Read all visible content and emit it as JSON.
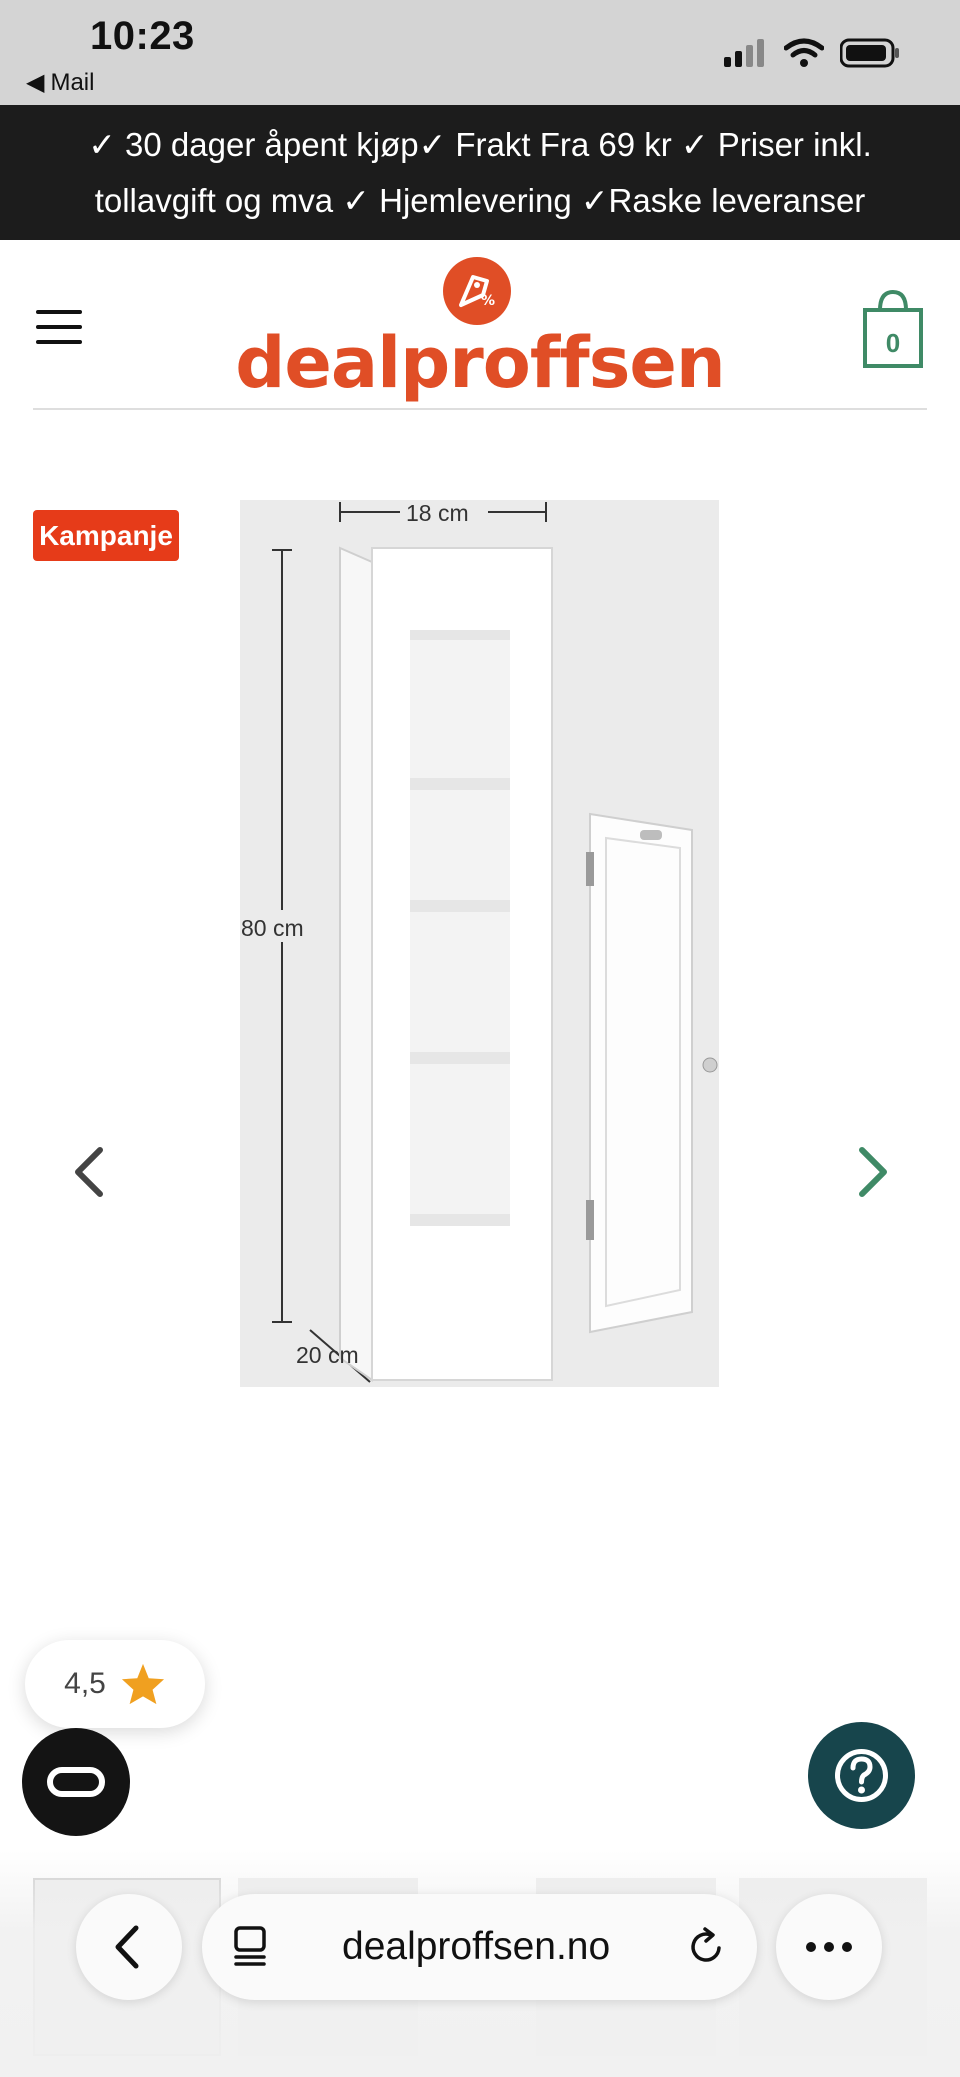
{
  "status_bar": {
    "time": "10:23",
    "back_app": "Mail"
  },
  "promo_banner": {
    "text": "✓ 30 dager åpent kjøp✓ Frakt Fra 69 kr ✓ Priser inkl. tollavgift og mva ✓ Hjemlevering ✓Raske leveranser"
  },
  "header": {
    "logo_text": "dealproffsen",
    "cart_count": "0"
  },
  "product": {
    "badge": "Kampanje",
    "dimensions": {
      "width": "18 cm",
      "height": "80 cm",
      "depth": "20 cm"
    }
  },
  "rating": {
    "value": "4,5"
  },
  "browser": {
    "url": "dealproffsen.no"
  },
  "colors": {
    "brand_orange": "#e04e26",
    "badge_red": "#e63b19",
    "cart_green": "#3f8a66",
    "help_teal": "#17454c",
    "star_orange": "#f0a020"
  },
  "icons": [
    "hamburger-icon",
    "shopping-bag-icon",
    "chevron-left-icon",
    "chevron-right-icon",
    "star-icon",
    "chat-icon",
    "help-icon",
    "back-icon",
    "tabs-icon",
    "reload-icon",
    "more-icon"
  ]
}
